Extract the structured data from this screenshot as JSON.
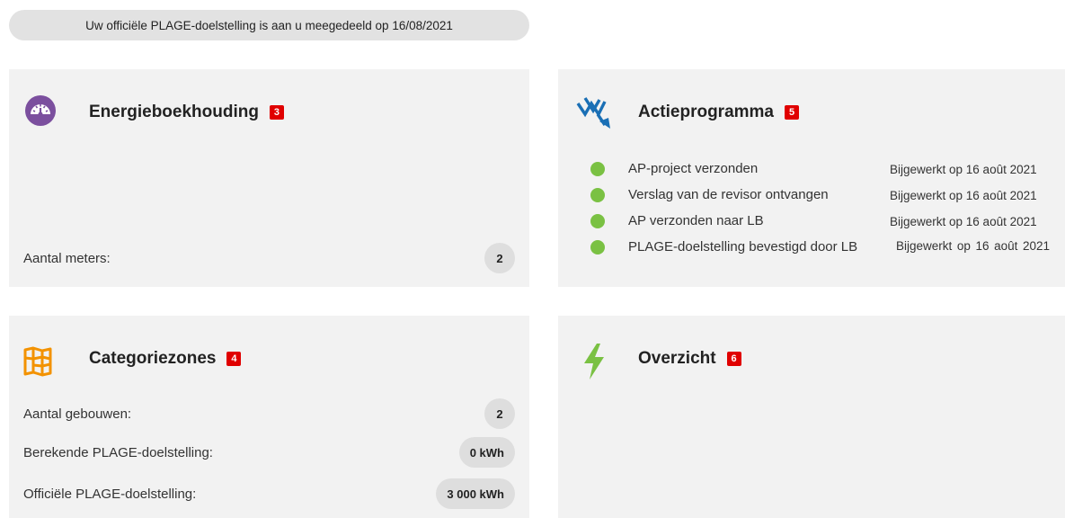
{
  "banner": {
    "text": "Uw officiële PLAGE-doelstelling is aan u meegedeeld op 16/08/2021"
  },
  "energie": {
    "title": "Energieboekhouding",
    "marker": "3",
    "icon": "gauge-icon",
    "rows": [
      {
        "label": "Aantal meters:",
        "value": "2"
      }
    ]
  },
  "actie": {
    "title": "Actieprogramma",
    "marker": "5",
    "icon": "trend-down-icon",
    "items": [
      {
        "label": "AP-project verzonden",
        "date": "Bijgewerkt op 16 août 2021",
        "status_color": "#7ac143"
      },
      {
        "label": "Verslag van de revisor ontvangen",
        "date": "Bijgewerkt op 16 août 2021",
        "status_color": "#7ac143"
      },
      {
        "label": "AP verzonden naar LB",
        "date": "Bijgewerkt op 16 août 2021",
        "status_color": "#7ac143"
      },
      {
        "label": "PLAGE-doelstelling bevestigd door LB",
        "date": "Bijgewerkt op 16 août 2021",
        "status_color": "#7ac143"
      }
    ]
  },
  "categorie": {
    "title": "Categoriezones",
    "marker": "4",
    "icon": "map-icon",
    "rows": [
      {
        "label": "Aantal gebouwen:",
        "value": "2"
      },
      {
        "label": "Berekende PLAGE-doelstelling:",
        "value": "0 kWh"
      },
      {
        "label": "Officiële PLAGE-doelstelling:",
        "value": "3 000 kWh"
      }
    ]
  },
  "overzicht": {
    "title": "Overzicht",
    "marker": "6",
    "icon": "lightning-icon"
  },
  "colors": {
    "accent_purple": "#7b4f9e",
    "accent_blue": "#1a6fb5",
    "accent_orange": "#f39200",
    "accent_green": "#7ac143",
    "marker_red": "#e00000"
  }
}
